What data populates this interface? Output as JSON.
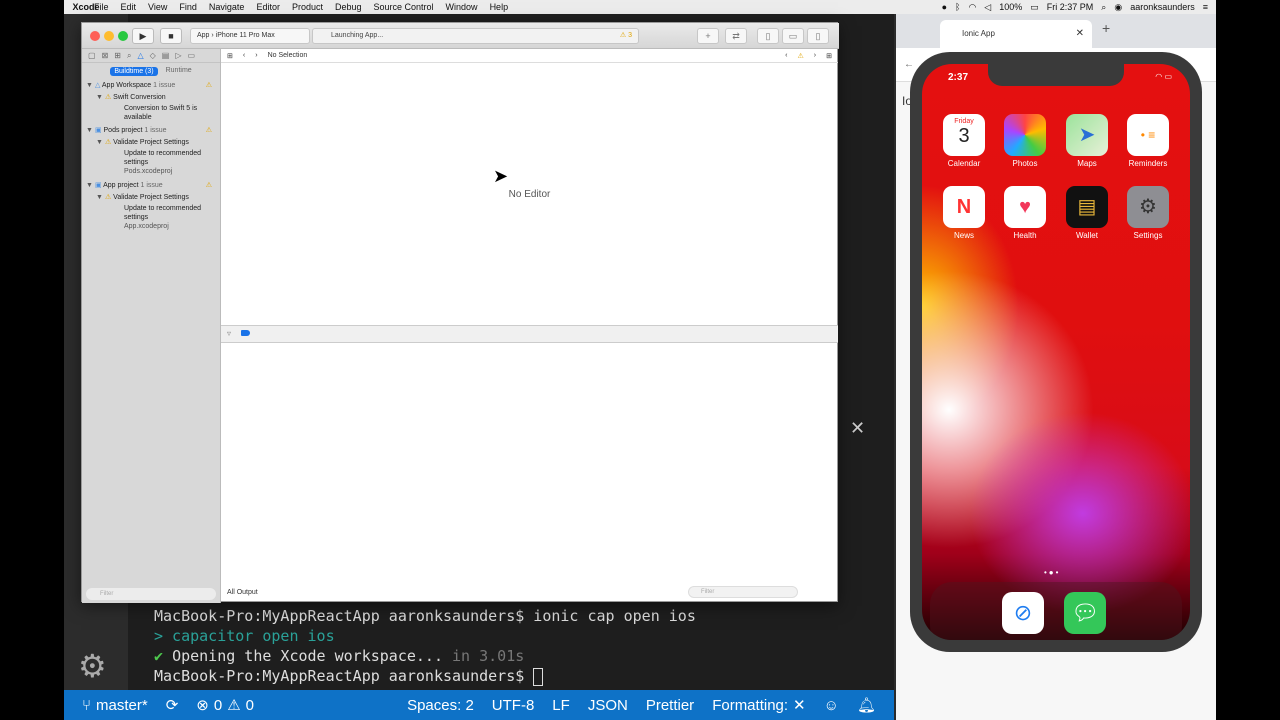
{
  "menubar": {
    "app": "Xcode",
    "items": [
      "File",
      "Edit",
      "View",
      "Find",
      "Navigate",
      "Editor",
      "Product",
      "Debug",
      "Source Control",
      "Window",
      "Help"
    ],
    "battery": "100%",
    "clock": "Fri 2:37 PM",
    "user": "aaronksaunders"
  },
  "xcode": {
    "scheme_app": "App",
    "scheme_device": "iPhone 11 Pro Max",
    "activity": "Launching App...",
    "warning_count": "3",
    "seg_buildtime": "Buildtime (3)",
    "seg_runtime": "Runtime",
    "issues": [
      {
        "title": "App Workspace",
        "count": "1 issue",
        "group": "Swift Conversion",
        "detail": "Conversion to Swift 5 is available",
        "file": ""
      },
      {
        "title": "Pods project",
        "count": "1 issue",
        "group": "Validate Project Settings",
        "detail": "Update to recommended settings",
        "file": "Pods.xcodeproj"
      },
      {
        "title": "App project",
        "count": "1 issue",
        "group": "Validate Project Settings",
        "detail": "Update to recommended settings",
        "file": "App.xcodeproj"
      }
    ],
    "nav_filter_placeholder": "Filter",
    "jump_selection": "No Selection",
    "no_editor": "No Editor",
    "output_selector": "All Output",
    "debug_filter_placeholder": "Filter"
  },
  "terminal": {
    "line1": "MacBook-Pro:MyAppReactApp aaronksaunders$ ionic cap open ios",
    "line2": "> capacitor open ios",
    "line3_check": "✔",
    "line3": "Opening the Xcode workspace...",
    "line3_time": "in 3.01s",
    "line4": "MacBook-Pro:MyAppReactApp aaronksaunders$"
  },
  "statusbar": {
    "branch": "master*",
    "errors": "0",
    "warnings": "0",
    "spaces": "Spaces: 2",
    "encoding": "UTF-8",
    "eol": "LF",
    "language": "JSON",
    "prettier": "Prettier",
    "formatting": "Formatting:"
  },
  "browser": {
    "tab_title": "Ionic App",
    "page_label": "Io"
  },
  "iphone": {
    "time": "2:37",
    "calendar_day": "Friday",
    "calendar_date": "3",
    "apps": [
      "Calendar",
      "Photos",
      "Maps",
      "Reminders",
      "News",
      "Health",
      "Wallet",
      "Settings"
    ],
    "dock": [
      "safari-icon",
      "messages-icon"
    ],
    "colors": {
      "wallpaper_primary": "#e41010",
      "accent": "#c13be0"
    }
  }
}
